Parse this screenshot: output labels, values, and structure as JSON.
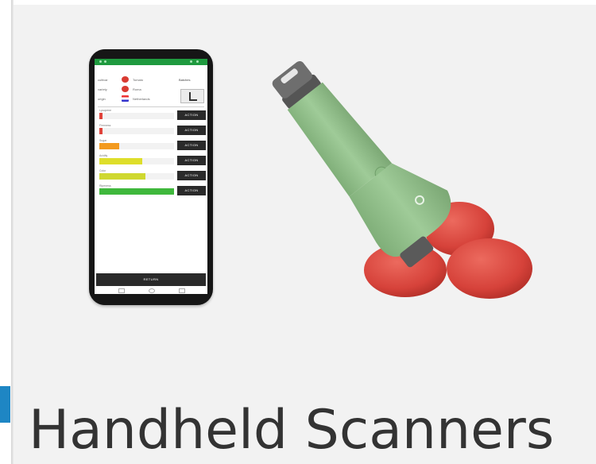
{
  "card": {
    "title": "Handheld Scanners",
    "accent_color": "#1e86c4",
    "title_color": "#333333"
  },
  "phone_screen": {
    "header_rows": [
      {
        "label": "cultivar",
        "name": "Tomato"
      },
      {
        "label": "variety",
        "name": "Roma"
      },
      {
        "label": "origin",
        "name": "Netherlands"
      }
    ],
    "header_right_label": "Batches",
    "measurements": [
      {
        "label": "Lycopene",
        "level": 0.04,
        "color": "#e0433b",
        "action": "ACTION"
      },
      {
        "label": "Firmness",
        "level": 0.04,
        "color": "#e0433b",
        "action": "ACTION"
      },
      {
        "label": "Sugar",
        "level": 0.27,
        "color": "#f39a1f",
        "action": "ACTION"
      },
      {
        "label": "Acidity",
        "level": 0.57,
        "color": "#dede2a",
        "action": "ACTION"
      },
      {
        "label": "Color",
        "level": 0.62,
        "color": "#cfd830",
        "action": "ACTION"
      },
      {
        "label": "Ripeness",
        "level": 1.0,
        "color": "#3fb83c",
        "action": "ACTION"
      }
    ],
    "return_label": "RETURN"
  },
  "icons": {
    "phone": "smartphone-app-illustration",
    "scanner": "handheld-scanner-illustration",
    "tomatoes": "tomato-icon"
  }
}
